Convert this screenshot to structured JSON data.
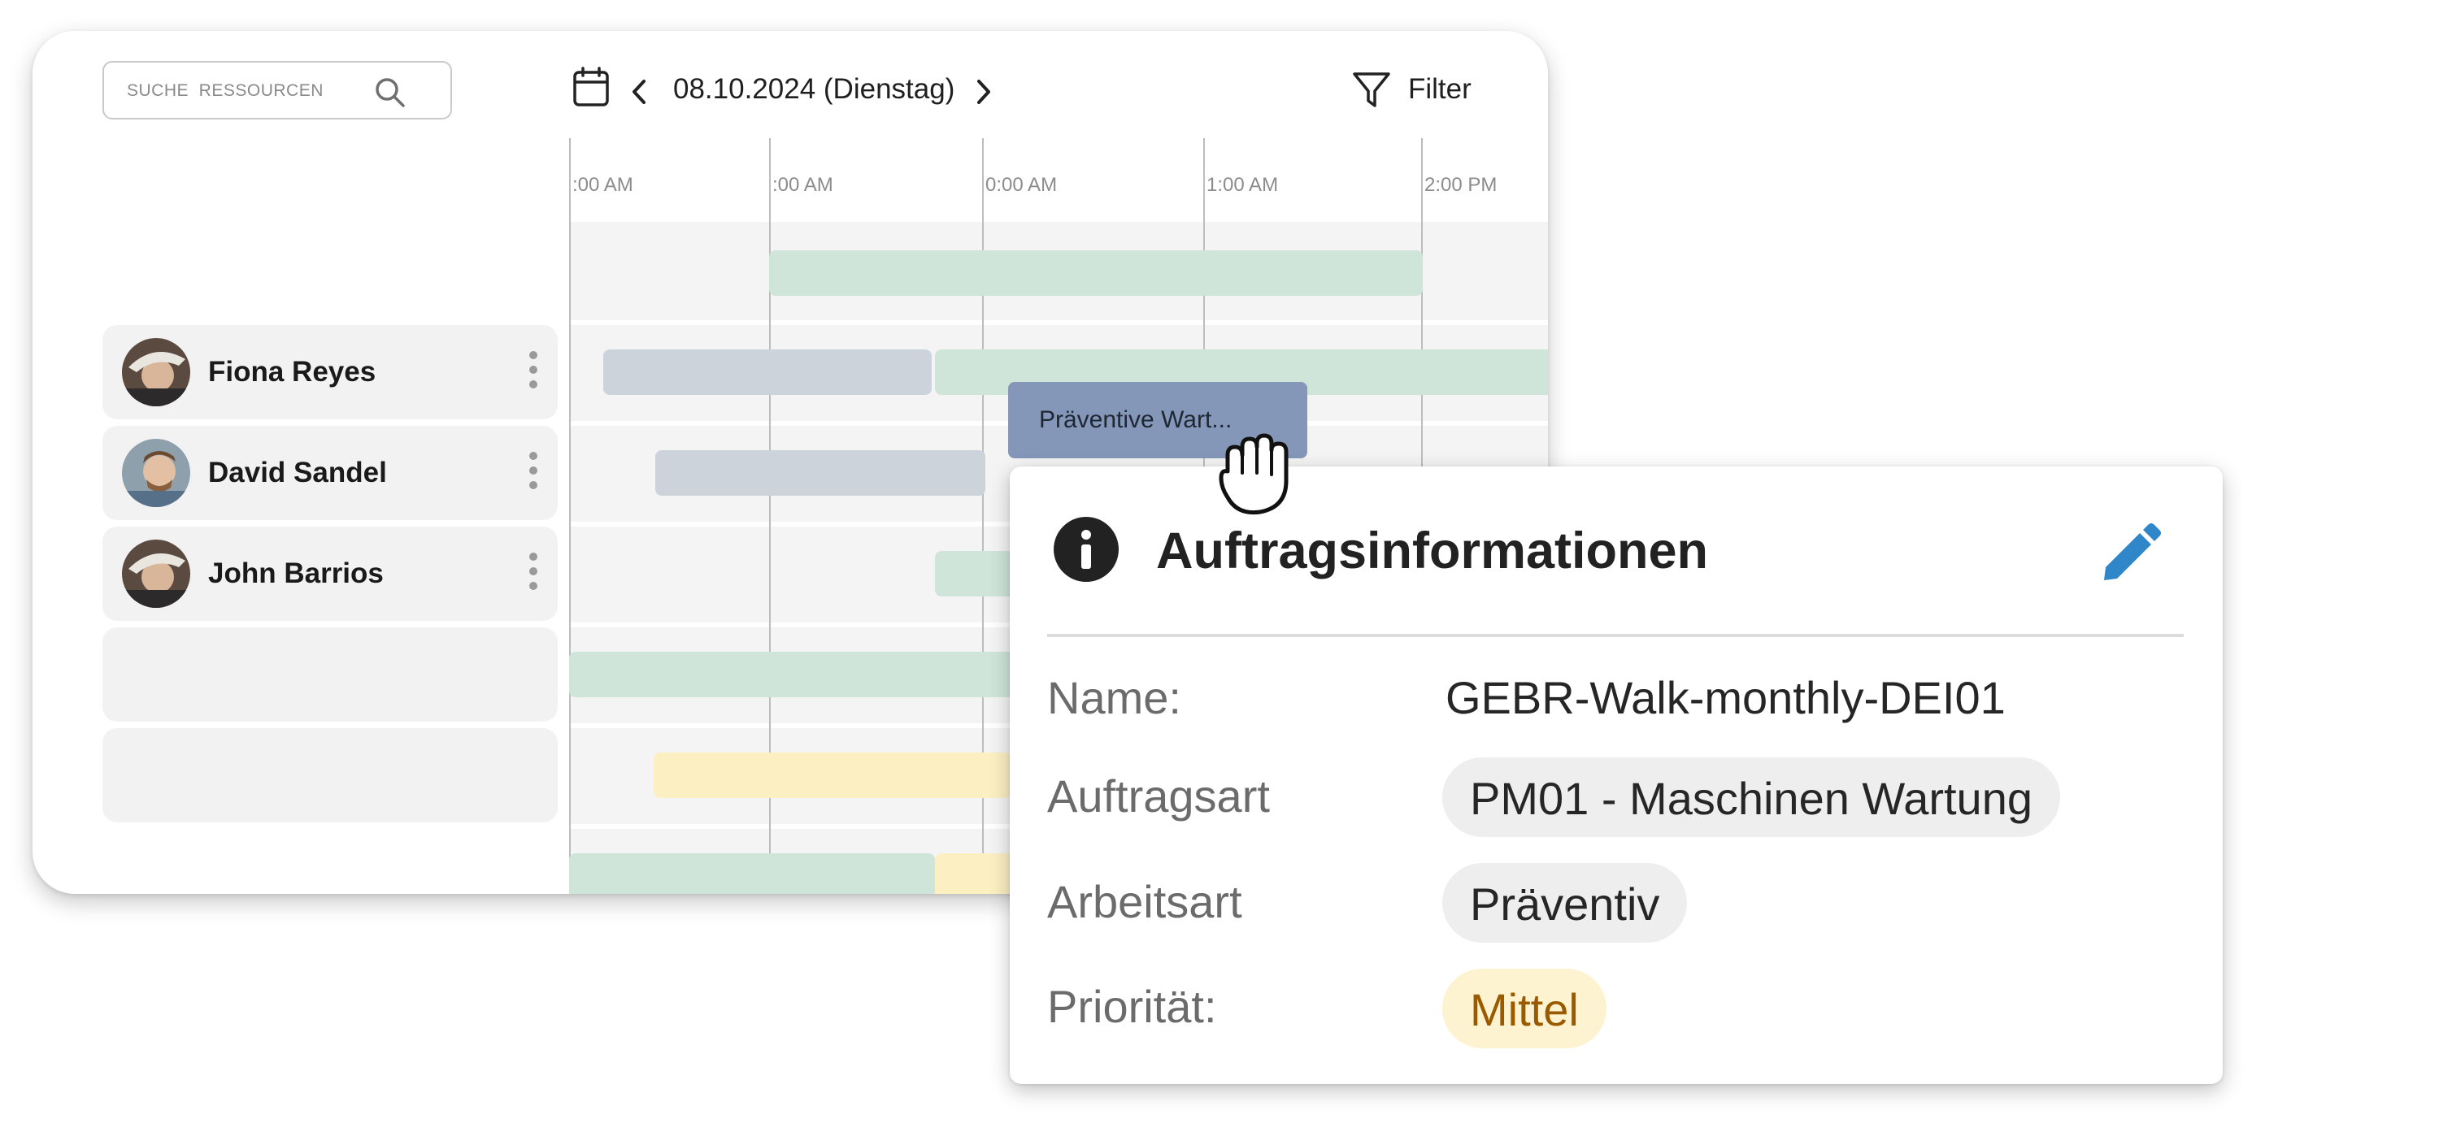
{
  "search": {
    "placeholder": "SUCHE  RESSOURCEN",
    "icon": "search-icon"
  },
  "header": {
    "date": "08.10.2024 (Dienstag)",
    "filter_label": "Filter"
  },
  "timeline": {
    "hours": [
      ":00 AM",
      ":00 AM",
      "0:00 AM",
      "1:00 AM",
      "2:00 PM"
    ]
  },
  "resources": [
    {
      "name": "Fiona Reyes"
    },
    {
      "name": "David Sandel"
    },
    {
      "name": "John Barrios"
    },
    {
      "name": ""
    },
    {
      "name": ""
    }
  ],
  "dragged_order": {
    "label": "Präventive Wart..."
  },
  "popup": {
    "title": "Auftragsinformationen",
    "fields": [
      {
        "label": "Name:",
        "value": "GEBR-Walk-monthly-DEI01"
      },
      {
        "label": "Auftragsart",
        "value": "PM01 - Maschinen Wartung"
      },
      {
        "label": "Arbeitsart",
        "value": "Präventiv"
      },
      {
        "label": "Priorität:",
        "value": "Mittel"
      }
    ]
  },
  "colors": {
    "bar_green": "#cfe5da",
    "bar_gray": "#cdd3db",
    "bar_yellow": "#fcefc2",
    "dragged_chip": "#8497b8",
    "edit_icon": "#2f86c8",
    "priority_text": "#9a5a00",
    "priority_bg": "#fdf3d0"
  }
}
